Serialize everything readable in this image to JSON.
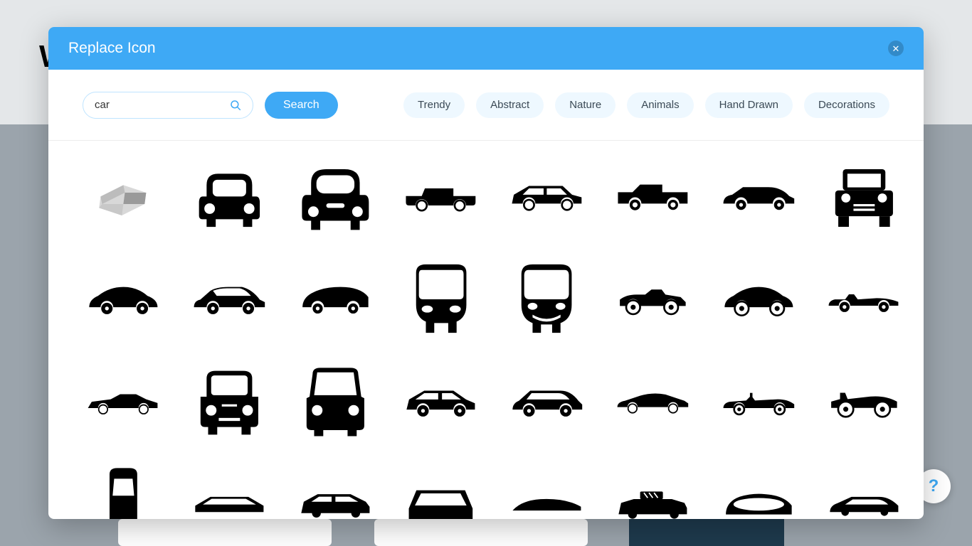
{
  "modal": {
    "title": "Replace Icon",
    "close_symbol": "✕"
  },
  "search": {
    "value": "car",
    "button_label": "Search"
  },
  "categories": [
    "Trendy",
    "Abstract",
    "Nature",
    "Animals",
    "Hand Drawn",
    "Decorations"
  ],
  "help_button": "?",
  "icons": {
    "row1": [
      "isometric-car",
      "car-front",
      "car-front-rounded",
      "sedan-side",
      "hatchback-side",
      "van-side",
      "coupe-side",
      "jeep-front"
    ],
    "row2": [
      "beetle-side",
      "sedan-side-2",
      "minivan-side",
      "smart-front",
      "smart-front-smile",
      "hotrod-side",
      "beetle-side-2",
      "roadster-side"
    ],
    "row3": [
      "muscle-side",
      "compact-front",
      "van-front",
      "hatchback-side-2",
      "crossover-side",
      "sports-side",
      "convertible-side",
      "vintage-race-side"
    ],
    "row4": [
      "car-top",
      "hatch-silhouette",
      "suv-silhouette",
      "car-front-simple",
      "sports-silhouette",
      "taxi-side",
      "car-cover",
      "modern-side"
    ]
  }
}
